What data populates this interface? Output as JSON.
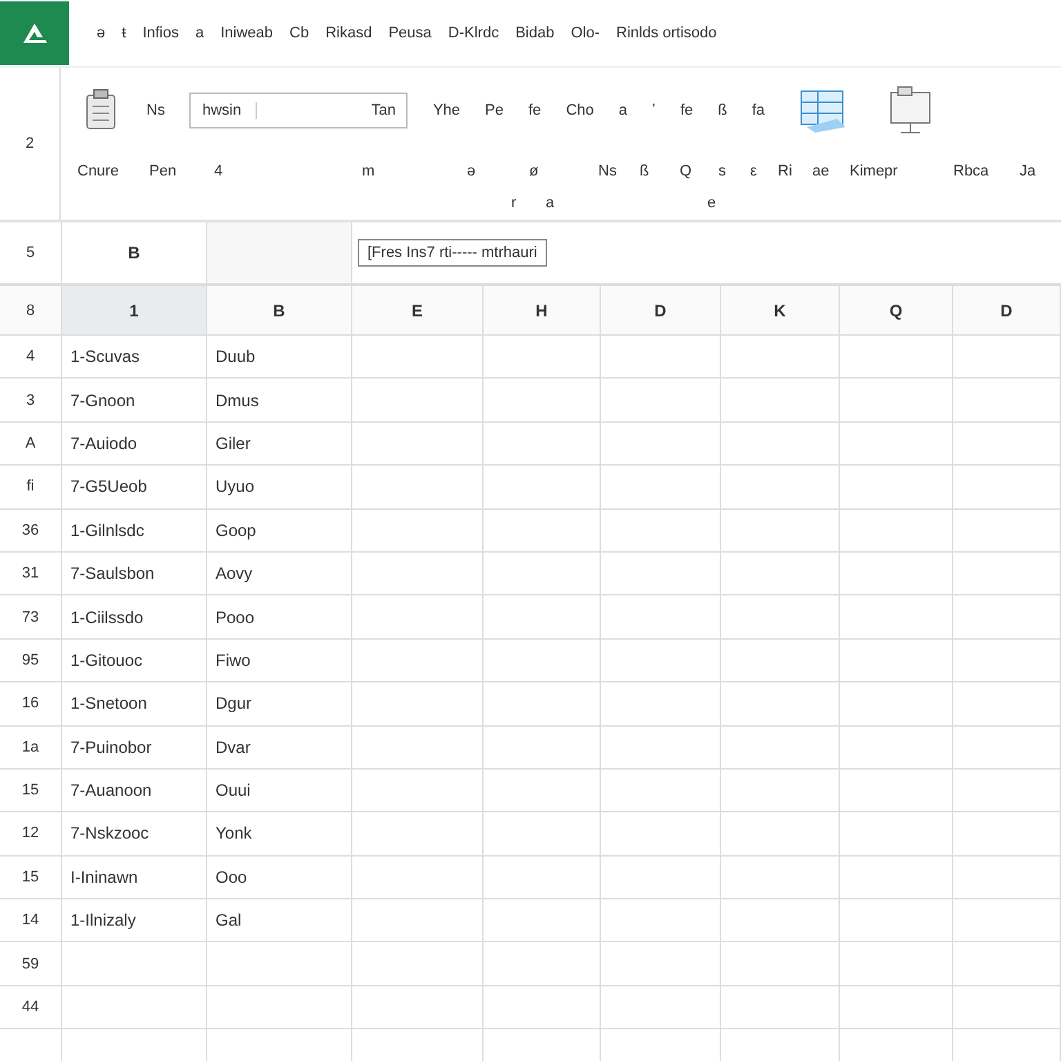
{
  "menu": [
    "ə",
    "ŧ",
    "Infios",
    "a",
    "Iniweab",
    "Cb",
    "Rikasd",
    "Peusa",
    "D-Klrdc",
    "Bidab",
    "Olo-",
    "Rinlds ortisodo"
  ],
  "ribbon": {
    "row_label": "2",
    "row_1": [
      "Ns",
      "Yhe",
      "Pe",
      "fe",
      "Cho",
      "a",
      "ʼ",
      "fe",
      "ß",
      "fa"
    ],
    "font_box": {
      "value": "hwsin",
      "dropdown": "Tan"
    },
    "row_2": [
      "Cnure",
      "Pen",
      "4",
      "m",
      "ə",
      "ø",
      "Ns",
      "ß",
      "Q",
      "s",
      "ε",
      "Ri",
      "ae",
      "Kimepr",
      "Rbca",
      "Ja"
    ],
    "row_3": [
      "r",
      "a",
      "e"
    ]
  },
  "formula_bar": {
    "row_label": "5",
    "name_box": "B",
    "formula": "[Fres Ins7 rti----- mtrhauri"
  },
  "sheet": {
    "corner": "8",
    "columns": [
      {
        "label": "1",
        "selected": true
      },
      {
        "label": "B",
        "selected": false
      },
      {
        "label": "E",
        "selected": false
      },
      {
        "label": "H",
        "selected": false
      },
      {
        "label": "D",
        "selected": false
      },
      {
        "label": "K",
        "selected": false
      },
      {
        "label": "Q",
        "selected": false
      },
      {
        "label": "D",
        "selected": false
      }
    ],
    "rows": [
      {
        "label": "4",
        "cells": [
          "1-Scuvas",
          "Duub"
        ]
      },
      {
        "label": "3",
        "cells": [
          "7-Gnoon",
          "Dmus"
        ]
      },
      {
        "label": "A",
        "cells": [
          "7-Auiodo",
          "Giler"
        ]
      },
      {
        "label": "fi",
        "cells": [
          "7-G5Ueob",
          "Uyuo"
        ]
      },
      {
        "label": "36",
        "cells": [
          "1-Gilnlsdc",
          "Goop"
        ]
      },
      {
        "label": "31",
        "cells": [
          "7-Saulsbon",
          "Aovy"
        ]
      },
      {
        "label": "73",
        "cells": [
          "1-Ciilssdo",
          "Pooo"
        ]
      },
      {
        "label": "95",
        "cells": [
          "1-Gitouoc",
          "Fiwo"
        ]
      },
      {
        "label": "16",
        "cells": [
          "1-Snetoon",
          "Dgur"
        ]
      },
      {
        "label": "1a",
        "cells": [
          "7-Puinobor",
          "Dvar"
        ]
      },
      {
        "label": "15",
        "cells": [
          "7-Auanoon",
          "Ouui"
        ]
      },
      {
        "label": "12",
        "cells": [
          "7-Nskzooc",
          "Yonk"
        ]
      },
      {
        "label": "15",
        "cells": [
          "I-Ininawn",
          "Ooo"
        ]
      },
      {
        "label": "14",
        "cells": [
          "1-Ilnizaly",
          "Gal"
        ]
      },
      {
        "label": "59",
        "cells": []
      },
      {
        "label": "44",
        "cells": []
      },
      {
        "label": "",
        "cells": []
      }
    ]
  }
}
